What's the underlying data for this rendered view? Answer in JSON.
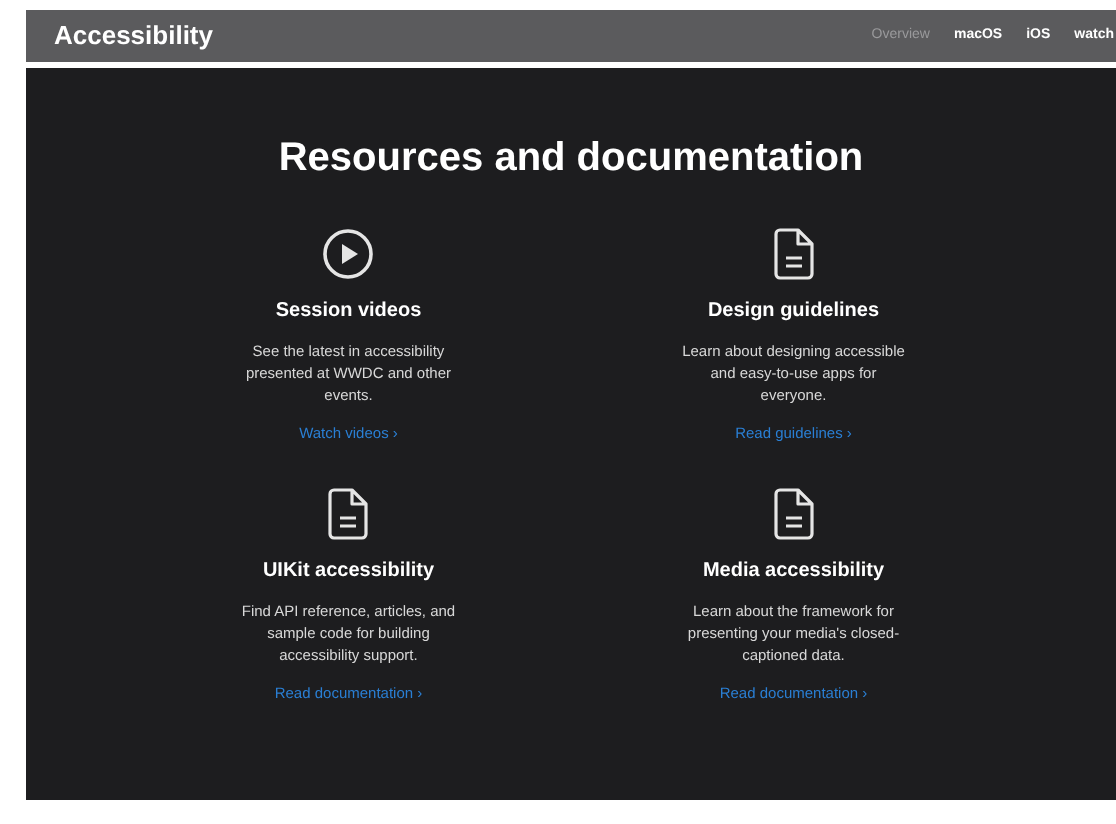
{
  "nav": {
    "title": "Accessibility",
    "links": [
      {
        "label": "Overview",
        "selected": true
      },
      {
        "label": "macOS",
        "selected": false
      },
      {
        "label": "iOS",
        "selected": false
      },
      {
        "label": "watch",
        "selected": false
      }
    ]
  },
  "heading": "Resources and documentation",
  "cards": [
    {
      "kind": "video",
      "title": "Session videos",
      "text": "See the latest in accessibility presented at WWDC and other events.",
      "link": "Watch videos ›"
    },
    {
      "kind": "document",
      "title": "Design guidelines",
      "text": "Learn about designing accessible and easy-to-use apps for everyone.",
      "link": "Read guidelines ›"
    },
    {
      "kind": "document",
      "title": "UIKit accessibility",
      "text": "Find API reference, articles, and sample code for building accessibility support.",
      "link": "Read documentation ›"
    },
    {
      "kind": "document",
      "title": "Media accessibility",
      "text": "Learn about the framework for presenting your media's closed-captioned data.",
      "link": "Read documentation ›"
    }
  ]
}
